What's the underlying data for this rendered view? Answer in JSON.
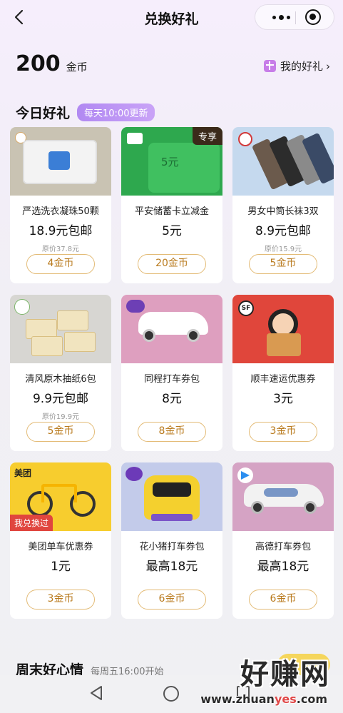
{
  "header": {
    "title": "兑换好礼"
  },
  "wallet": {
    "coins": "200",
    "unit": "金币",
    "my_gifts": "我的好礼"
  },
  "today": {
    "title": "今日好礼",
    "badge": "每天10:00更新"
  },
  "items": [
    {
      "name": "严选洗衣凝珠50颗",
      "price": "18.9元包邮",
      "orig": "原价37.8元",
      "cost": "4金币"
    },
    {
      "name": "平安储蓄卡立减金",
      "price": "5元",
      "orig": "",
      "cost": "20金币",
      "tag": "专享",
      "thumb_text": "5元"
    },
    {
      "name": "男女中筒长袜3双",
      "price": "8.9元包邮",
      "orig": "原价15.9元",
      "cost": "5金币"
    },
    {
      "name": "清风原木抽纸6包",
      "price": "9.9元包邮",
      "orig": "原价19.9元",
      "cost": "5金币"
    },
    {
      "name": "同程打车券包",
      "price": "8元",
      "orig": "",
      "cost": "8金币"
    },
    {
      "name": "顺丰速运优惠券",
      "price": "3元",
      "orig": "",
      "cost": "3金币",
      "logo_text": "SF"
    },
    {
      "name": "美团单车优惠券",
      "price": "1元",
      "orig": "",
      "cost": "3金币",
      "brand": "美团",
      "used": "我兑换过"
    },
    {
      "name": "花小猪打车券包",
      "price": "最高18元",
      "orig": "",
      "cost": "6金币"
    },
    {
      "name": "高德打车券包",
      "price": "最高18元",
      "orig": "",
      "cost": "6金币"
    }
  ],
  "weekend": {
    "title": "周末好心情",
    "sub": "每周五16:00开始"
  },
  "watermark": {
    "big": "好赚网",
    "site_a": "www.zhuan",
    "site_b": "yes",
    "site_c": ".com"
  },
  "colors": {
    "accent": "#b97a1d",
    "badge": "#b189f2",
    "green": "#2ea84e"
  }
}
